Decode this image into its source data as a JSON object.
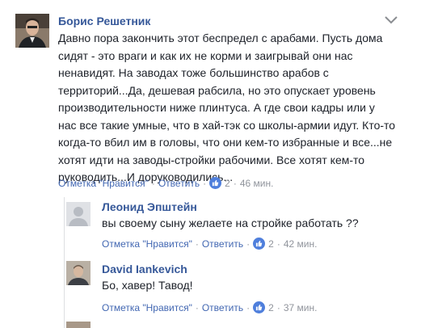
{
  "comments": [
    {
      "author": "Борис Решетник",
      "lines": [
        "Давно пора закончить этот беспредел с арабами. Пусть дома",
        "сидят - это враги и как их не корми и заигрывай они нас",
        "ненавидят. На заводах тоже большинство арабов с",
        "территорий...Да, дешевая рабсила, но это опускает уровень",
        "производительности ниже плинтуса. А где свои кадры или у",
        "нас все такие умные, что в хай-тэк со школы-армии идут. Кто-то",
        "когда-то вбил им в головы, что они кем-то избранные и все...не",
        "хотят идти на заводы-стройки рабочими. Все хотят кем-то",
        "руководить...И доруководились..."
      ],
      "actions": {
        "mark": "Отметка \"Нравится\"",
        "reply": "Ответить",
        "likes": "2",
        "time": "46 мин."
      }
    },
    {
      "author": "Леонид Эпштейн",
      "lines": [
        "вы своему сыну желаете на стройке работать ??"
      ],
      "actions": {
        "mark": "Отметка \"Нравится\"",
        "reply": "Ответить",
        "likes": "2",
        "time": "42 мин."
      }
    },
    {
      "author": "David Iankevich",
      "lines": [
        "Бо, хавер! Тавод!"
      ],
      "actions": {
        "mark": "Отметка \"Нравится\"",
        "reply": "Ответить",
        "likes": "2",
        "time": "37 мин."
      }
    }
  ],
  "separator": "·",
  "icons": {
    "options": "chevron-down-icon",
    "like": "thumbs-up-icon"
  },
  "colors": {
    "author": "#365899",
    "link": "#4267b2",
    "meta": "#90949c",
    "like_badge": "#4f7fdc"
  }
}
